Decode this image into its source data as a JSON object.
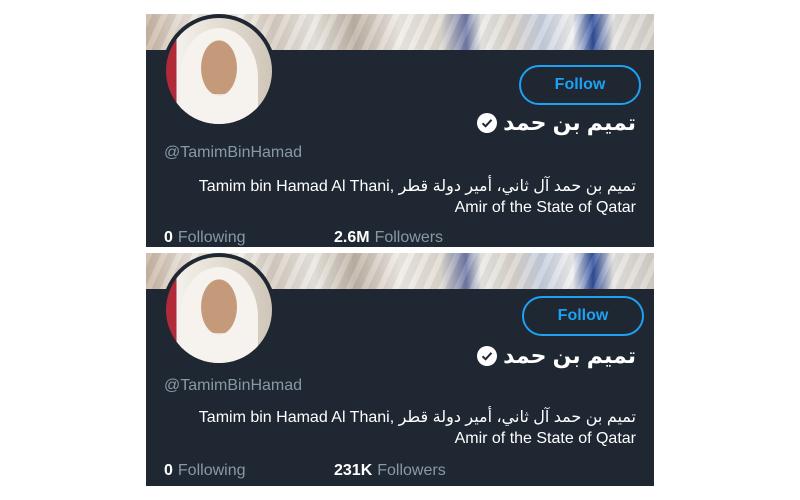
{
  "cards": [
    {
      "follow_label": "Follow",
      "display_name": "تميم بن حمد",
      "handle": "@TamimBinHamad",
      "bio_line1": "Tamim bin Hamad Al Thani, تميم بن حمد آل ثاني، أمير دولة قطر",
      "bio_line2": "Amir of the State of Qatar",
      "following_count": "0",
      "following_label": "Following",
      "followers_count": "2.6M",
      "followers_label": "Followers"
    },
    {
      "follow_label": "Follow",
      "display_name": "تميم بن حمد",
      "handle": "@TamimBinHamad",
      "bio_line1": "Tamim bin Hamad Al Thani, تميم بن حمد آل ثاني، أمير دولة قطر",
      "bio_line2": "Amir of the State of Qatar",
      "following_count": "0",
      "following_label": "Following",
      "followers_count": "231K",
      "followers_label": "Followers"
    }
  ],
  "colors": {
    "card_bg": "#1f2733",
    "accent": "#1da1f2",
    "muted": "#8899a6",
    "text": "#ffffff"
  },
  "icons": {
    "verified": "verified-badge-icon"
  }
}
